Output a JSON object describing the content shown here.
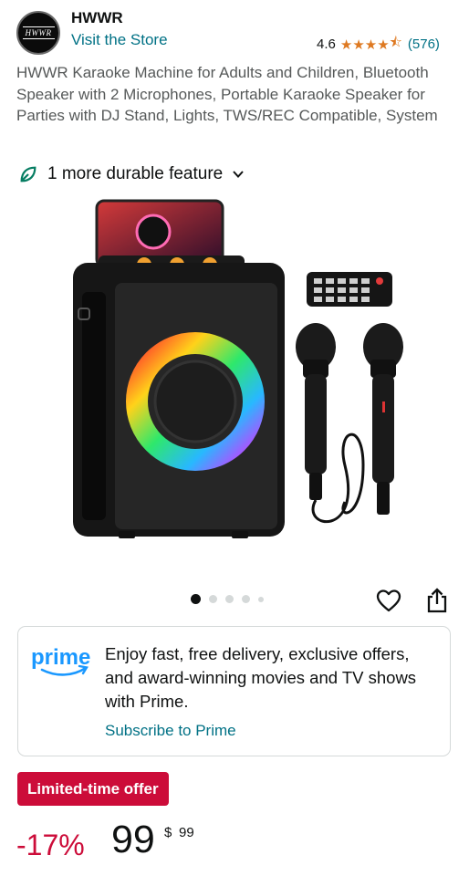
{
  "store": {
    "logo_text": "HWWR",
    "brand": "HWWR",
    "visit_label": "Visit the Store",
    "rating": "4.6",
    "review_count": "(576)"
  },
  "product": {
    "title": "HWWR Karaoke Machine for Adults and Children, Bluetooth Speaker with 2 Microphones, Portable Karaoke Speaker for Parties with DJ Stand, Lights, TWS/REC Compatible, System",
    "durable_feature": "1 more durable feature",
    "image_count": 5,
    "active_image": 1
  },
  "icons": {
    "leaf": "leaf-icon",
    "chevron": "chevron-down-icon",
    "heart": "heart-icon",
    "share": "share-icon"
  },
  "prime": {
    "logo": "prime",
    "message": "Enjoy fast, free delivery, exclusive offers, and award-winning movies and TV shows with Prime.",
    "cta": "Subscribe to Prime"
  },
  "deal": {
    "badge": "Limited-time offer",
    "discount": "-17%",
    "currency": "$",
    "price_whole": "99",
    "price_fraction": "99"
  },
  "colors": {
    "link": "#007185",
    "deal_red": "#cc0c39",
    "star": "#de7921",
    "prime_blue": "#1a98ff"
  }
}
